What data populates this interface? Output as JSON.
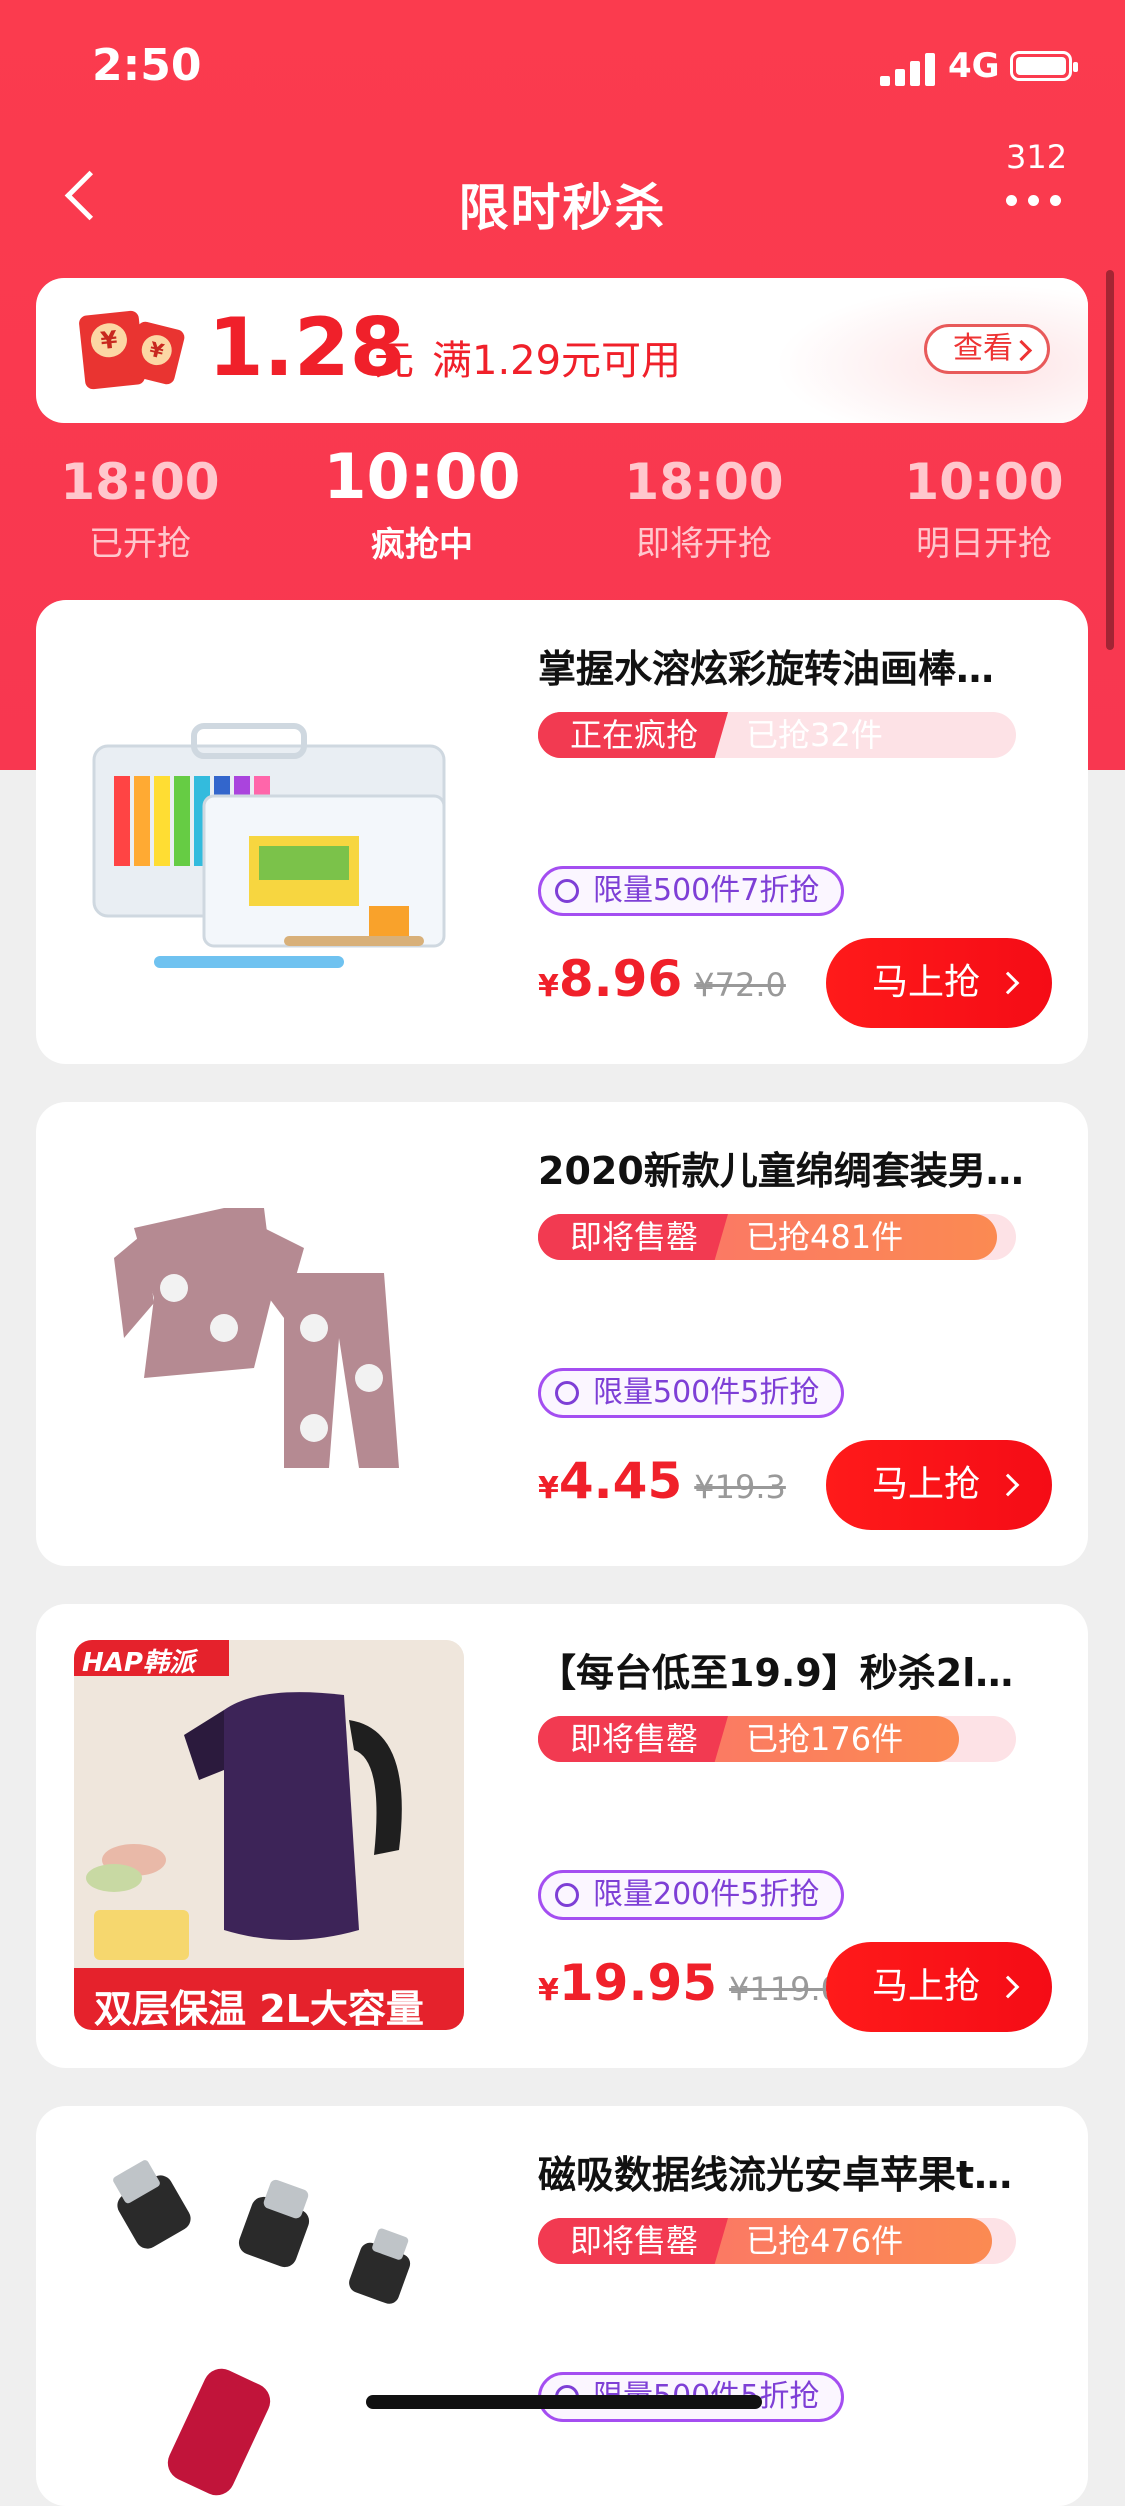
{
  "status_bar": {
    "time": "2:50",
    "network": "4G"
  },
  "nav": {
    "title": "限时秒杀",
    "badge": "312"
  },
  "coupon": {
    "amount": "1.28",
    "unit": "元",
    "condition": "满1.29元可用",
    "view_label": "查看"
  },
  "session_tabs": [
    {
      "time": "18:00",
      "status": "已开抢"
    },
    {
      "time": "10:00",
      "status": "疯抢中",
      "active": true
    },
    {
      "time": "18:00",
      "status": "即将开抢"
    },
    {
      "time": "10:00",
      "status": "明日开抢"
    }
  ],
  "products": [
    {
      "title": "掌握水溶炫彩旋转油画棒…",
      "status": "正在疯抢",
      "sold": "已抢32件",
      "sold_progress": 0.3,
      "limit": "限量500件7折抢",
      "price_symbol": "¥",
      "price": "8.96",
      "original_price": "¥72.0",
      "button": "马上抢"
    },
    {
      "title": "2020新款儿童绵绸套装男…",
      "status": "即将售罄",
      "sold": "已抢481件",
      "sold_progress": 0.96,
      "limit": "限量500件5折抢",
      "price_symbol": "¥",
      "price": "4.45",
      "original_price": "¥19.3",
      "button": "马上抢"
    },
    {
      "title": "【每台低至19.9】秒杀2l…",
      "status": "即将售罄",
      "sold": "已抢176件",
      "sold_progress": 0.88,
      "limit": "限量200件5折抢",
      "price_symbol": "¥",
      "price": "19.95",
      "original_price": "¥119.0",
      "button": "马上抢",
      "image_brand": "HAP韩派",
      "image_caption": "双层保温 2L大容量"
    },
    {
      "title": "磁吸数据线流光安卓苹果t…",
      "status": "即将售罄",
      "sold": "已抢476件",
      "sold_progress": 0.95,
      "limit": "限量500件5折抢"
    }
  ],
  "colors": {
    "header": "#fb3b4e",
    "price": "#f0202a",
    "button": "#f50c16",
    "limit_border": "#a44ef1"
  }
}
